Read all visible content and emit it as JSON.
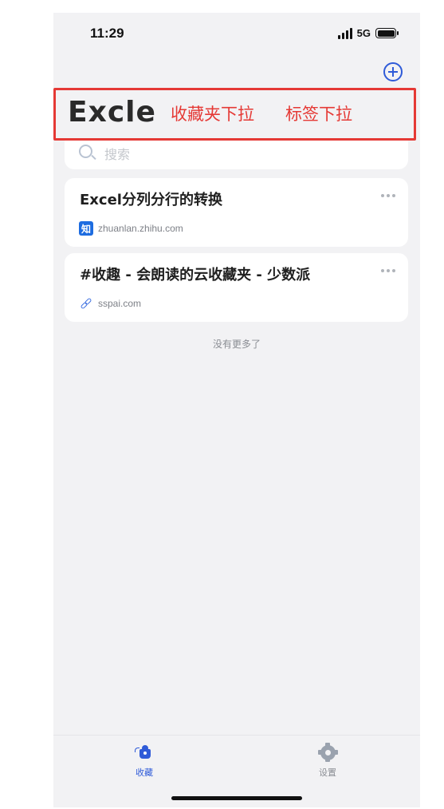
{
  "status_bar": {
    "time": "11:29",
    "network": "5G"
  },
  "header": {
    "title": "Excle",
    "annotation_collection_dropdown": "收藏夹下拉",
    "annotation_tag_dropdown": "标签下拉"
  },
  "search": {
    "placeholder": "搜索"
  },
  "items": [
    {
      "title": "Excel分列分行的转换",
      "source_icon_text": "知",
      "source_icon": "zhihu-icon",
      "source": "zhuanlan.zhihu.com"
    },
    {
      "title": "#收趣 - 会朗读的云收藏夹 - 少数派",
      "source_icon": "link-icon",
      "source": "sspai.com"
    }
  ],
  "list_footer": "没有更多了",
  "tabbar": {
    "tabs": [
      {
        "label": "收藏",
        "icon": "collection-icon",
        "active": true
      },
      {
        "label": "设置",
        "icon": "settings-gear-icon",
        "active": false
      }
    ]
  },
  "colors": {
    "accent": "#2f5bd8",
    "annotation": "#e53935",
    "background": "#f2f2f4"
  }
}
